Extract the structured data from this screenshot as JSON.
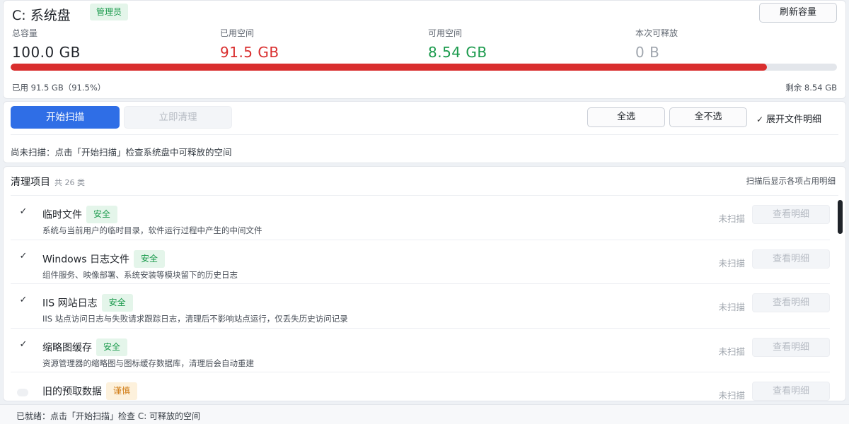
{
  "disk": {
    "title": "C: 系统盘",
    "badge": "管理员",
    "refresh_label": "刷新容量",
    "stats": {
      "total": {
        "label": "总容量",
        "value": "100.0 GB"
      },
      "used": {
        "label": "已用空间",
        "value": "91.5 GB"
      },
      "free": {
        "label": "可用空间",
        "value": "8.54 GB"
      },
      "releasable": {
        "label": "本次可释放",
        "value": "0 B"
      }
    },
    "usage_fraction": 0.915,
    "used_caption": "已用 91.5 GB（91.5%）",
    "free_caption": "剩余 8.54 GB"
  },
  "toolbar": {
    "scan_label": "开始扫描",
    "clean_label": "立即清理",
    "select_all_label": "全选",
    "select_none_label": "全不选",
    "expand_label": "展开文件明细",
    "expand_checked": true,
    "status_message": "尚未扫描：点击「开始扫描」检查系统盘中可释放的空间"
  },
  "list": {
    "title": "清理项目",
    "count": "共 26 类",
    "hint": "扫描后显示各项占用明细",
    "items": [
      {
        "name": "临时文件",
        "tag": "安全",
        "checked": true,
        "desc": "系统与当前用户的临时目录，软件运行过程中产生的中间文件",
        "state": "未扫描",
        "detail_label": "查看明细"
      },
      {
        "name": "Windows 日志文件",
        "tag": "安全",
        "checked": true,
        "desc": "组件服务、映像部署、系统安装等模块留下的历史日志",
        "state": "未扫描",
        "detail_label": "查看明细"
      },
      {
        "name": "IIS 网站日志",
        "tag": "安全",
        "checked": true,
        "desc": "IIS 站点访问日志与失败请求跟踪日志，清理后不影响站点运行，仅丢失历史访问记录",
        "state": "未扫描",
        "detail_label": "查看明细"
      },
      {
        "name": "缩略图缓存",
        "tag": "安全",
        "checked": true,
        "desc": "资源管理器的缩略图与图标缓存数据库，清理后会自动重建",
        "state": "未扫描",
        "detail_label": "查看明细"
      },
      {
        "name": "旧的预取数据",
        "tag": "谨慎",
        "checked": false,
        "desc": "",
        "state": "未扫描",
        "detail_label": "查看明细"
      }
    ]
  },
  "statusbar": {
    "text": "已就绪：点击「开始扫描」检查 C: 可释放的空间"
  },
  "colors": {
    "accent": "#2f6ee6",
    "used": "#d92e2e",
    "free": "#1a9a4c",
    "releasable": "#a0a6ae",
    "safe_tag_text": "#1a9a4c",
    "safe_tag_bg": "#e4f5ea",
    "caution_tag_text": "#d07a12",
    "caution_tag_bg": "#fdf1dc"
  },
  "icons": {
    "check": "check-icon"
  }
}
